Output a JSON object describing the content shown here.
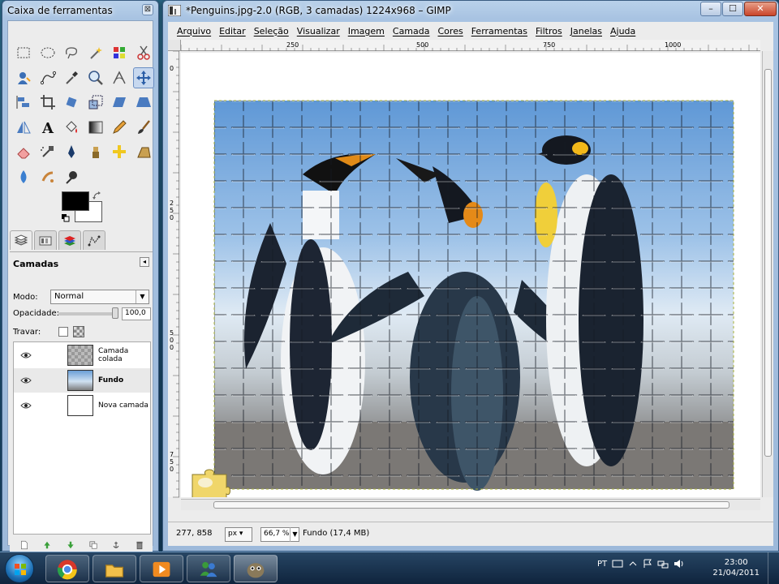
{
  "toolbox": {
    "title": "Caixa de ferramentas",
    "close_glyph": "⊠",
    "tools": [
      "rect-select-icon",
      "ellipse-select-icon",
      "lasso-icon",
      "fuzzy-select-icon",
      "color-select-icon",
      "scissors-icon",
      "foreground-select-icon",
      "paths-icon",
      "color-picker-icon",
      "zoom-icon",
      "measure-icon",
      "move-icon",
      "align-icon",
      "crop-icon",
      "rotate-icon",
      "scale-icon",
      "shear-icon",
      "perspective-icon",
      "flip-icon",
      "text-icon",
      "bucket-fill-icon",
      "blend-icon",
      "pencil-icon",
      "paintbrush-icon",
      "eraser-icon",
      "airbrush-icon",
      "ink-icon",
      "clone-icon",
      "heal-icon",
      "perspective-clone-icon",
      "blur-icon",
      "smudge-icon",
      "dodge-burn-icon"
    ],
    "active_tool": "move-icon",
    "fg_color": "#000000",
    "bg_color": "#ffffff"
  },
  "layers_panel": {
    "title": "Camadas",
    "mode_label": "Modo:",
    "mode_value": "Normal",
    "opacity_label": "Opacidade:",
    "opacity_value": "100,0",
    "lock_label": "Travar:",
    "layers": [
      {
        "name": "Camada colada",
        "thumb": "checker",
        "visible": true,
        "bold": false
      },
      {
        "name": "Fundo",
        "thumb": "penguins",
        "visible": true,
        "bold": true
      },
      {
        "name": "Nova camada",
        "thumb": "white",
        "visible": true,
        "bold": false
      }
    ],
    "buttons": [
      "new-layer-icon",
      "raise-layer-icon",
      "lower-layer-icon",
      "duplicate-layer-icon",
      "anchor-layer-icon",
      "delete-layer-icon"
    ]
  },
  "image_window": {
    "title": "*Penguins.jpg-2.0 (RGB, 3 camadas) 1224x968 – GIMP",
    "controls": {
      "minimize": "–",
      "maximize": "☐",
      "close": "✕"
    },
    "menu": [
      "Arquivo",
      "Editar",
      "Seleção",
      "Visualizar",
      "Imagem",
      "Camada",
      "Cores",
      "Ferramentas",
      "Filtros",
      "Janelas",
      "Ajuda"
    ],
    "ruler_h": [
      "250",
      "500",
      "750",
      "1000"
    ],
    "ruler_v": [
      "0",
      "250",
      "500",
      "750"
    ],
    "status": {
      "coords": "277, 858",
      "unit": "px",
      "zoom": "66,7 %",
      "layer_info": "Fundo (17,4 MB)"
    }
  },
  "taskbar": {
    "apps": [
      "chrome-icon",
      "explorer-icon",
      "media-player-icon",
      "messenger-icon",
      "gimp-icon"
    ],
    "active_app": "gimp-icon",
    "tray": {
      "lang": "PT"
    },
    "clock": {
      "time": "23:00",
      "date": "21/04/2011"
    }
  }
}
